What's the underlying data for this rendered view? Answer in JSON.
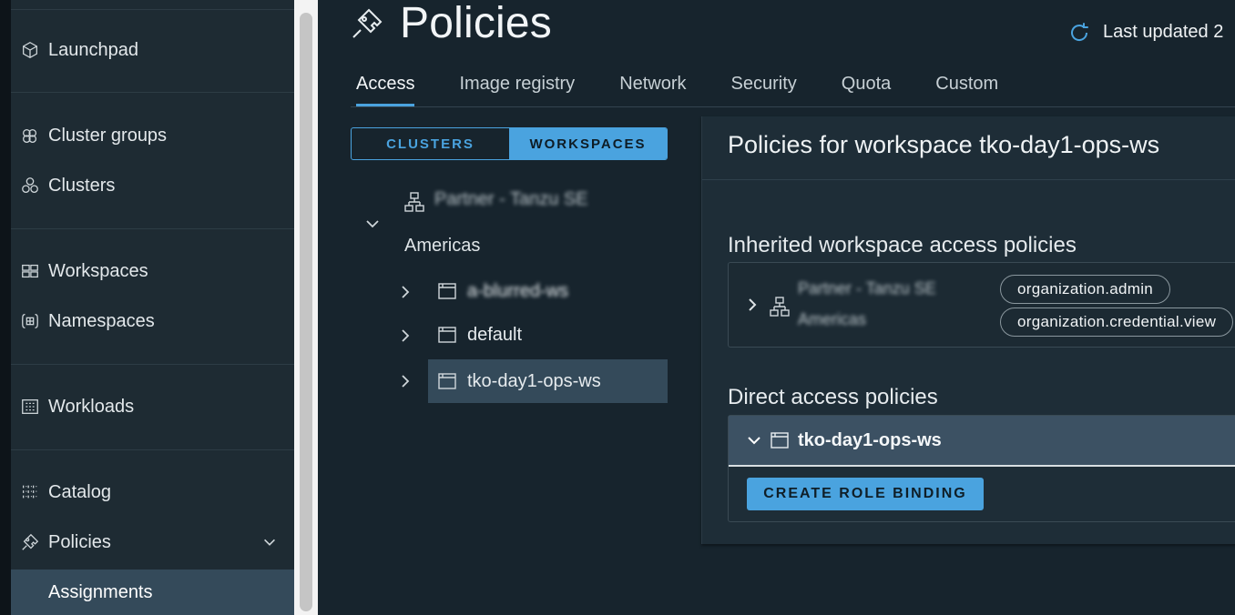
{
  "sidebar": {
    "items": [
      {
        "label": "Launchpad",
        "icon": "cube-icon"
      },
      {
        "label": "Cluster groups",
        "icon": "cluster-groups-icon"
      },
      {
        "label": "Clusters",
        "icon": "clusters-icon"
      },
      {
        "label": "Workspaces",
        "icon": "workspaces-icon"
      },
      {
        "label": "Namespaces",
        "icon": "namespaces-icon"
      },
      {
        "label": "Workloads",
        "icon": "workloads-icon"
      },
      {
        "label": "Catalog",
        "icon": "catalog-icon"
      },
      {
        "label": "Policies",
        "icon": "policies-icon"
      },
      {
        "label": "Assignments"
      }
    ]
  },
  "header": {
    "title": "Policies",
    "last_updated": "Last updated 2"
  },
  "tabs": [
    {
      "label": "Access"
    },
    {
      "label": "Image registry"
    },
    {
      "label": "Network"
    },
    {
      "label": "Security"
    },
    {
      "label": "Quota"
    },
    {
      "label": "Custom"
    }
  ],
  "toggle": {
    "clusters": "CLUSTERS",
    "workspaces": "WORKSPACES"
  },
  "tree": {
    "root_label": "Partner - Tanzu SE",
    "group_label": "Americas",
    "rows": [
      {
        "label": "a-blurred-ws"
      },
      {
        "label": "default"
      },
      {
        "label": "tko-day1-ops-ws"
      }
    ]
  },
  "panel": {
    "title": "Policies for workspace tko-day1-ops-ws",
    "inherited_title": "Inherited workspace access policies",
    "inherited_name_line1": "Partner - Tanzu SE",
    "inherited_name_line2": "Americas",
    "roles": [
      "organization.admin",
      "organization.credential.view"
    ],
    "direct_title": "Direct access policies",
    "direct_workspace": "tko-day1-ops-ws",
    "create_button": "CREATE ROLE BINDING"
  },
  "colors": {
    "accent": "#4aa3df",
    "sidebar_bg": "#1e2b33",
    "main_bg": "#17242d",
    "selected_bg": "#344a5a"
  }
}
